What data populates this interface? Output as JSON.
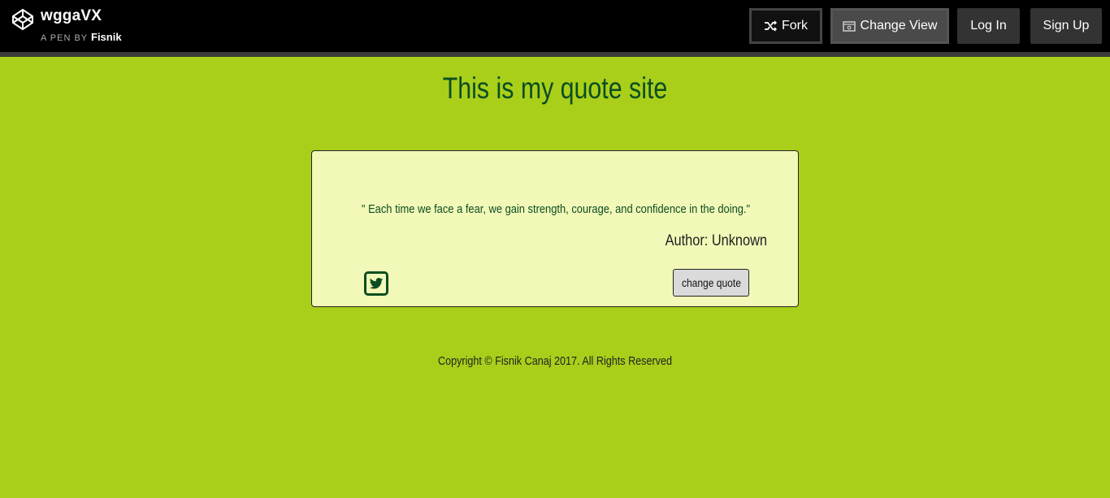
{
  "header": {
    "pen_title": "wggaVX",
    "pen_by_label": "A PEN BY",
    "author": "Fisnik",
    "fork_label": "Fork",
    "change_view_label": "Change View",
    "login_label": "Log In",
    "signup_label": "Sign Up"
  },
  "page": {
    "title": "This is my quote site"
  },
  "quote_card": {
    "quote": "\" Each time we face a fear, we gain strength, courage, and confidence in the doing.\"",
    "author": "Author: Unknown",
    "change_label": "change quote"
  },
  "footer": {
    "copyright": "Copyright © Fisnik Canaj 2017. All Rights Reserved"
  },
  "colors": {
    "background": "#a9cf1a",
    "card_background": "#f2f8b7",
    "accent_green": "#0b4d22",
    "topbar": "#000000"
  },
  "icons": {
    "logo": "codepen-logo-icon",
    "fork": "fork-icon",
    "change_view": "change-view-icon",
    "tweet": "twitter-icon"
  }
}
